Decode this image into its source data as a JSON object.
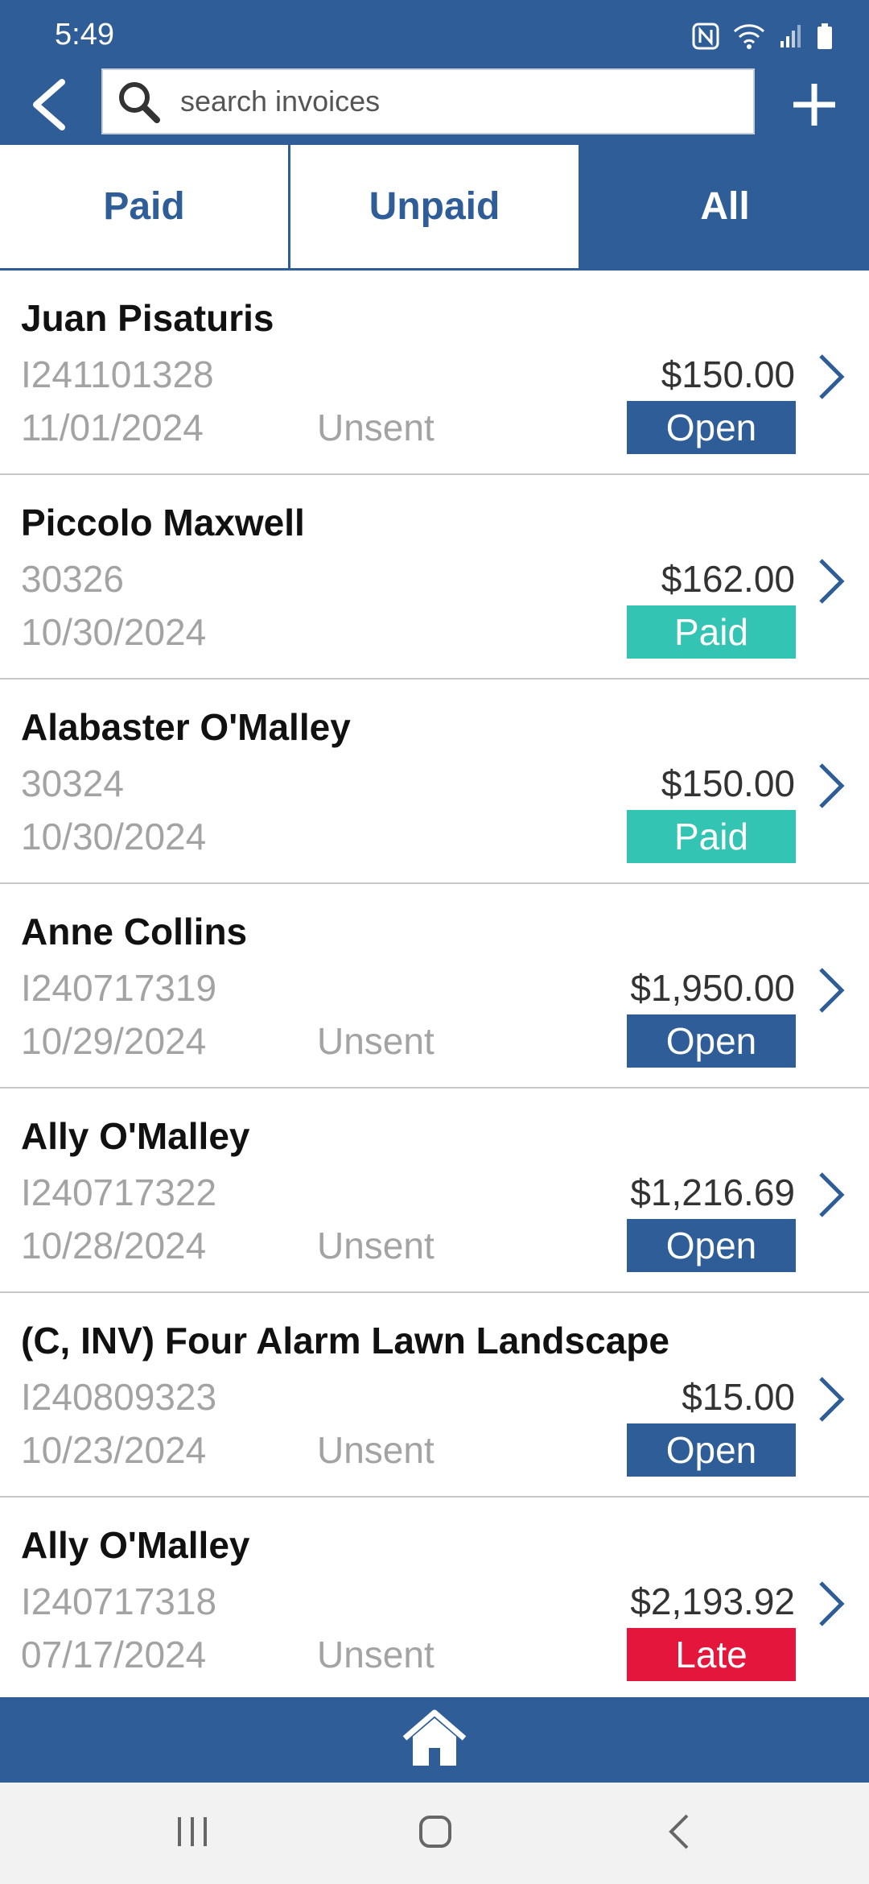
{
  "status_bar": {
    "time": "5:49",
    "icons": [
      "nfc-icon",
      "wifi-icon",
      "signal-icon",
      "battery-icon"
    ]
  },
  "toolbar": {
    "back_icon": "chevron-left-icon",
    "search_placeholder": "search invoices",
    "search_icon": "search-icon",
    "add_icon": "plus-icon"
  },
  "tabs": [
    {
      "label": "Paid",
      "active": false
    },
    {
      "label": "Unpaid",
      "active": false
    },
    {
      "label": "All",
      "active": true
    }
  ],
  "colors": {
    "brand": "#2e5d97",
    "open": "#2e5d97",
    "paid": "#34c4b3",
    "late": "#e5163c"
  },
  "invoices": [
    {
      "name": "Juan Pisaturis",
      "number": "I241101328",
      "date": "11/01/2024",
      "sent_status": "Unsent",
      "amount": "$150.00",
      "status": "Open"
    },
    {
      "name": "Piccolo Maxwell",
      "number": "30326",
      "date": "10/30/2024",
      "sent_status": "",
      "amount": "$162.00",
      "status": "Paid"
    },
    {
      "name": "Alabaster O'Malley",
      "number": "30324",
      "date": "10/30/2024",
      "sent_status": "",
      "amount": "$150.00",
      "status": "Paid"
    },
    {
      "name": "Anne Collins",
      "number": "I240717319",
      "date": "10/29/2024",
      "sent_status": "Unsent",
      "amount": "$1,950.00",
      "status": "Open"
    },
    {
      "name": "Ally O'Malley",
      "number": "I240717322",
      "date": "10/28/2024",
      "sent_status": "Unsent",
      "amount": "$1,216.69",
      "status": "Open"
    },
    {
      "name": "(C, INV) Four Alarm Lawn Landscape",
      "number": "I240809323",
      "date": "10/23/2024",
      "sent_status": "Unsent",
      "amount": "$15.00",
      "status": "Open"
    },
    {
      "name": "Ally O'Malley",
      "number": "I240717318",
      "date": "07/17/2024",
      "sent_status": "Unsent",
      "amount": "$2,193.92",
      "status": "Late"
    }
  ],
  "bottom_bar": {
    "home_icon": "home-icon"
  },
  "system_nav": [
    "recents-icon",
    "home-circle-icon",
    "system-back-icon"
  ]
}
